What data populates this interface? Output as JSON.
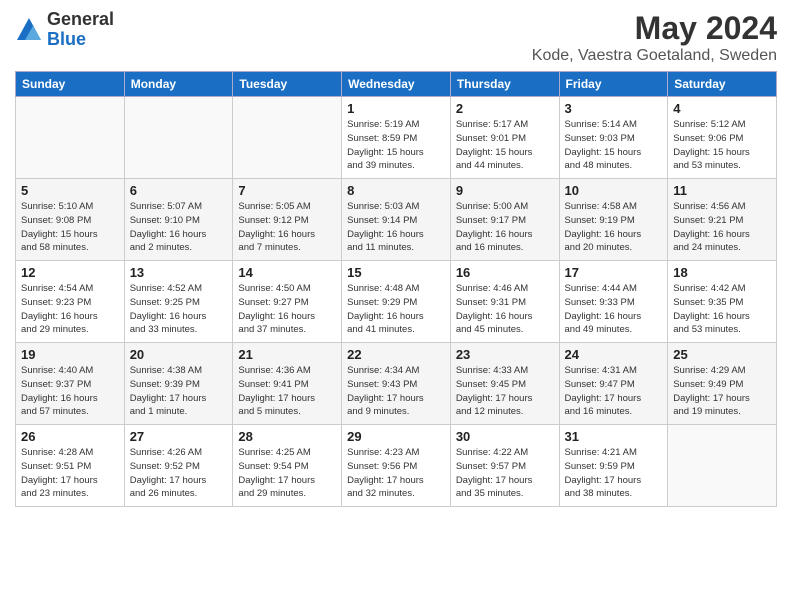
{
  "header": {
    "logo_general": "General",
    "logo_blue": "Blue",
    "title": "May 2024",
    "subtitle": "Kode, Vaestra Goetaland, Sweden"
  },
  "days_of_week": [
    "Sunday",
    "Monday",
    "Tuesday",
    "Wednesday",
    "Thursday",
    "Friday",
    "Saturday"
  ],
  "weeks": [
    [
      {
        "day": "",
        "info": ""
      },
      {
        "day": "",
        "info": ""
      },
      {
        "day": "",
        "info": ""
      },
      {
        "day": "1",
        "info": "Sunrise: 5:19 AM\nSunset: 8:59 PM\nDaylight: 15 hours\nand 39 minutes."
      },
      {
        "day": "2",
        "info": "Sunrise: 5:17 AM\nSunset: 9:01 PM\nDaylight: 15 hours\nand 44 minutes."
      },
      {
        "day": "3",
        "info": "Sunrise: 5:14 AM\nSunset: 9:03 PM\nDaylight: 15 hours\nand 48 minutes."
      },
      {
        "day": "4",
        "info": "Sunrise: 5:12 AM\nSunset: 9:06 PM\nDaylight: 15 hours\nand 53 minutes."
      }
    ],
    [
      {
        "day": "5",
        "info": "Sunrise: 5:10 AM\nSunset: 9:08 PM\nDaylight: 15 hours\nand 58 minutes."
      },
      {
        "day": "6",
        "info": "Sunrise: 5:07 AM\nSunset: 9:10 PM\nDaylight: 16 hours\nand 2 minutes."
      },
      {
        "day": "7",
        "info": "Sunrise: 5:05 AM\nSunset: 9:12 PM\nDaylight: 16 hours\nand 7 minutes."
      },
      {
        "day": "8",
        "info": "Sunrise: 5:03 AM\nSunset: 9:14 PM\nDaylight: 16 hours\nand 11 minutes."
      },
      {
        "day": "9",
        "info": "Sunrise: 5:00 AM\nSunset: 9:17 PM\nDaylight: 16 hours\nand 16 minutes."
      },
      {
        "day": "10",
        "info": "Sunrise: 4:58 AM\nSunset: 9:19 PM\nDaylight: 16 hours\nand 20 minutes."
      },
      {
        "day": "11",
        "info": "Sunrise: 4:56 AM\nSunset: 9:21 PM\nDaylight: 16 hours\nand 24 minutes."
      }
    ],
    [
      {
        "day": "12",
        "info": "Sunrise: 4:54 AM\nSunset: 9:23 PM\nDaylight: 16 hours\nand 29 minutes."
      },
      {
        "day": "13",
        "info": "Sunrise: 4:52 AM\nSunset: 9:25 PM\nDaylight: 16 hours\nand 33 minutes."
      },
      {
        "day": "14",
        "info": "Sunrise: 4:50 AM\nSunset: 9:27 PM\nDaylight: 16 hours\nand 37 minutes."
      },
      {
        "day": "15",
        "info": "Sunrise: 4:48 AM\nSunset: 9:29 PM\nDaylight: 16 hours\nand 41 minutes."
      },
      {
        "day": "16",
        "info": "Sunrise: 4:46 AM\nSunset: 9:31 PM\nDaylight: 16 hours\nand 45 minutes."
      },
      {
        "day": "17",
        "info": "Sunrise: 4:44 AM\nSunset: 9:33 PM\nDaylight: 16 hours\nand 49 minutes."
      },
      {
        "day": "18",
        "info": "Sunrise: 4:42 AM\nSunset: 9:35 PM\nDaylight: 16 hours\nand 53 minutes."
      }
    ],
    [
      {
        "day": "19",
        "info": "Sunrise: 4:40 AM\nSunset: 9:37 PM\nDaylight: 16 hours\nand 57 minutes."
      },
      {
        "day": "20",
        "info": "Sunrise: 4:38 AM\nSunset: 9:39 PM\nDaylight: 17 hours\nand 1 minute."
      },
      {
        "day": "21",
        "info": "Sunrise: 4:36 AM\nSunset: 9:41 PM\nDaylight: 17 hours\nand 5 minutes."
      },
      {
        "day": "22",
        "info": "Sunrise: 4:34 AM\nSunset: 9:43 PM\nDaylight: 17 hours\nand 9 minutes."
      },
      {
        "day": "23",
        "info": "Sunrise: 4:33 AM\nSunset: 9:45 PM\nDaylight: 17 hours\nand 12 minutes."
      },
      {
        "day": "24",
        "info": "Sunrise: 4:31 AM\nSunset: 9:47 PM\nDaylight: 17 hours\nand 16 minutes."
      },
      {
        "day": "25",
        "info": "Sunrise: 4:29 AM\nSunset: 9:49 PM\nDaylight: 17 hours\nand 19 minutes."
      }
    ],
    [
      {
        "day": "26",
        "info": "Sunrise: 4:28 AM\nSunset: 9:51 PM\nDaylight: 17 hours\nand 23 minutes."
      },
      {
        "day": "27",
        "info": "Sunrise: 4:26 AM\nSunset: 9:52 PM\nDaylight: 17 hours\nand 26 minutes."
      },
      {
        "day": "28",
        "info": "Sunrise: 4:25 AM\nSunset: 9:54 PM\nDaylight: 17 hours\nand 29 minutes."
      },
      {
        "day": "29",
        "info": "Sunrise: 4:23 AM\nSunset: 9:56 PM\nDaylight: 17 hours\nand 32 minutes."
      },
      {
        "day": "30",
        "info": "Sunrise: 4:22 AM\nSunset: 9:57 PM\nDaylight: 17 hours\nand 35 minutes."
      },
      {
        "day": "31",
        "info": "Sunrise: 4:21 AM\nSunset: 9:59 PM\nDaylight: 17 hours\nand 38 minutes."
      },
      {
        "day": "",
        "info": ""
      }
    ]
  ]
}
